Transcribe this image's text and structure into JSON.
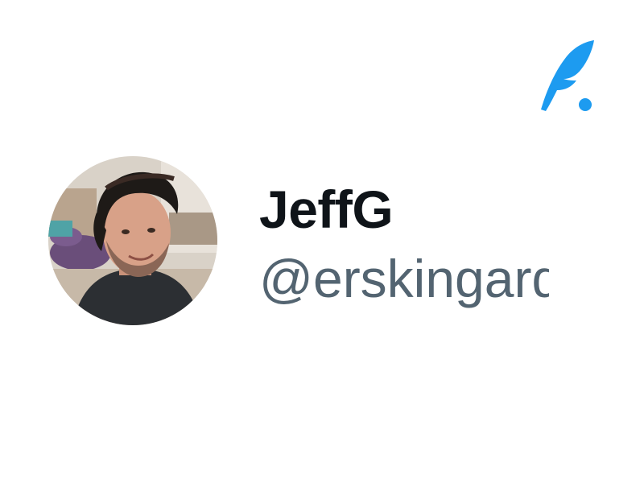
{
  "profile": {
    "display_name": "JeffG",
    "handle": "@erskingardner",
    "avatar_alt": "profile photo"
  },
  "brand": {
    "logo_icon": "feather-quill-icon",
    "accent_color": "#1d9bf0"
  },
  "colors": {
    "name_color": "#0f1419",
    "handle_color": "#536471",
    "background": "#ffffff"
  }
}
